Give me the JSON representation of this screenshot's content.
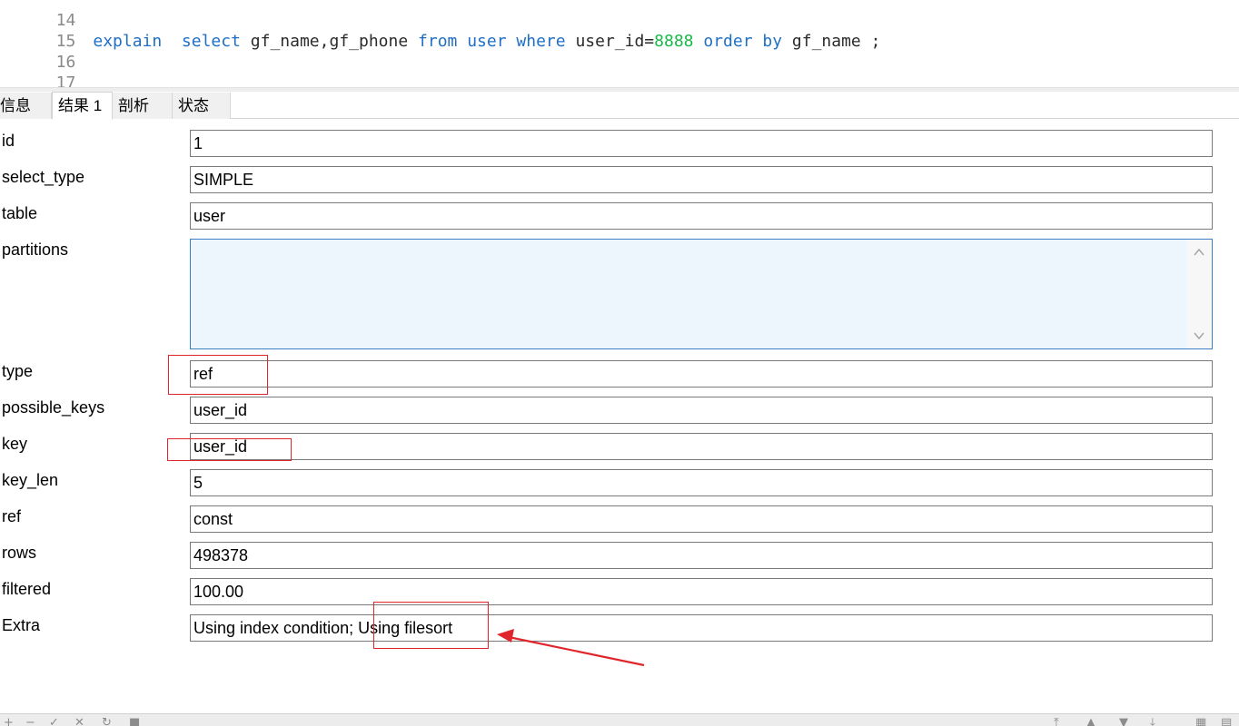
{
  "editor": {
    "lines": [
      {
        "no": "14"
      },
      {
        "no": "15",
        "tokens": {
          "explain": "explain",
          "select": "select",
          "cols": "gf_name,gf_phone",
          "from": "from",
          "table": "user",
          "where": "where",
          "cond": "user_id=",
          "value": "8888",
          "order_by": "order by",
          "order_col": "gf_name",
          "end": ";"
        }
      },
      {
        "no": "16"
      },
      {
        "no": "17"
      }
    ]
  },
  "tabs": [
    {
      "label": "信息",
      "active": false
    },
    {
      "label": "结果 1",
      "active": true
    },
    {
      "label": "剖析",
      "active": false
    },
    {
      "label": "状态",
      "active": false
    }
  ],
  "result": {
    "fields": [
      {
        "label": "id",
        "value": "1"
      },
      {
        "label": "select_type",
        "value": "SIMPLE"
      },
      {
        "label": "table",
        "value": "user"
      },
      {
        "label": "partitions",
        "value": ""
      },
      {
        "label": "type",
        "value": "ref"
      },
      {
        "label": "possible_keys",
        "value": "user_id"
      },
      {
        "label": "key",
        "value": "user_id"
      },
      {
        "label": "key_len",
        "value": "5"
      },
      {
        "label": "ref",
        "value": "const"
      },
      {
        "label": "rows",
        "value": "498378"
      },
      {
        "label": "filtered",
        "value": "100.00"
      },
      {
        "label": "Extra",
        "value": "Using index condition; Using filesort"
      }
    ]
  },
  "annotation": {
    "color": "#e0262c"
  },
  "icons": {
    "scroll_up": "chevron-up-icon",
    "scroll_down": "chevron-down-icon",
    "arrow": "red-arrow-icon"
  }
}
